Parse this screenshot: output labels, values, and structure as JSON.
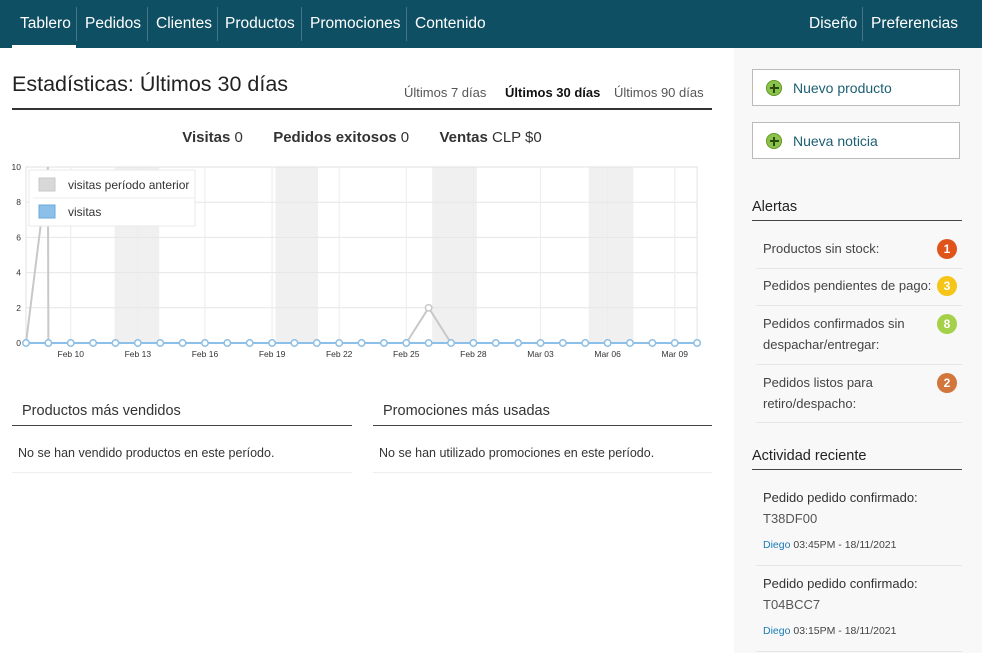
{
  "nav": {
    "left": [
      "Tablero",
      "Pedidos",
      "Clientes",
      "Productos",
      "Promociones",
      "Contenido"
    ],
    "right": [
      "Diseño",
      "Preferencias"
    ],
    "active": "Tablero"
  },
  "stats": {
    "title": "Estadísticas: Últimos 30 días",
    "periods": [
      "Últimos 7 días",
      "Últimos 30 días",
      "Últimos 90 días"
    ],
    "active_period": "Últimos 30 días",
    "summary": {
      "visitas_label": "Visitas",
      "visitas_value": "0",
      "pedidos_label": "Pedidos exitosos",
      "pedidos_value": "0",
      "ventas_label": "Ventas",
      "ventas_value": "CLP $0"
    }
  },
  "chart_data": {
    "type": "line",
    "title": "",
    "xlabel": "",
    "ylabel": "",
    "ylim": [
      0,
      10
    ],
    "y_ticks": [
      "0",
      "2",
      "4",
      "6",
      "8",
      "10"
    ],
    "x_ticks": [
      "Feb 10",
      "Feb 13",
      "Feb 16",
      "Feb 19",
      "Feb 22",
      "Feb 25",
      "Feb 28",
      "Mar 03",
      "Mar 06",
      "Mar 09"
    ],
    "x_start": "Feb 08",
    "x_end": "Mar 10",
    "weekend_shading": true,
    "grid": true,
    "legend_position": "top-left",
    "series": [
      {
        "name": "visitas período anterior",
        "color": "#c8c8c8",
        "values": [
          0,
          0,
          0,
          0,
          0,
          0,
          0,
          0,
          0,
          0,
          0,
          0,
          0,
          0,
          0,
          0,
          0,
          0,
          2,
          0,
          0,
          0,
          0,
          0,
          0,
          0,
          0,
          0,
          0,
          0,
          0
        ],
        "extra_points": [
          {
            "x": "Feb 09",
            "y": 10
          }
        ]
      },
      {
        "name": "visitas",
        "color": "#8cc0e8",
        "values": [
          0,
          0,
          0,
          0,
          0,
          0,
          0,
          0,
          0,
          0,
          0,
          0,
          0,
          0,
          0,
          0,
          0,
          0,
          0,
          0,
          0,
          0,
          0,
          0,
          0,
          0,
          0,
          0,
          0,
          0,
          0
        ]
      }
    ]
  },
  "panels": [
    {
      "title": "Productos más vendidos",
      "empty": "No se han vendido productos en este período."
    },
    {
      "title": "Promociones más usadas",
      "empty": "No se han utilizado promociones en este período."
    }
  ],
  "sidebar": {
    "buttons": [
      "Nuevo producto",
      "Nueva noticia"
    ],
    "alerts_title": "Alertas",
    "alerts": [
      {
        "line1": "Productos sin stock:",
        "line2": "",
        "count": "1",
        "color": "#e0541c"
      },
      {
        "line1": "Pedidos pendientes de pago:",
        "line2": "",
        "count": "3",
        "color": "#f5c518"
      },
      {
        "line1": "Pedidos confirmados sin",
        "line2": "despachar/entregar:",
        "count": "8",
        "color": "#a5d04a"
      },
      {
        "line1": "Pedidos listos para",
        "line2": "retiro/despacho:",
        "count": "2",
        "color": "#d2763c"
      }
    ],
    "activity_title": "Actividad reciente",
    "activity": [
      {
        "title": "Pedido pedido confirmado:",
        "code": "T38DF00",
        "user": "Diego",
        "time": "03:45PM - 18/11/2021"
      },
      {
        "title": "Pedido pedido confirmado:",
        "code": "T04BCC7",
        "user": "Diego",
        "time": "03:15PM - 18/11/2021"
      }
    ]
  }
}
